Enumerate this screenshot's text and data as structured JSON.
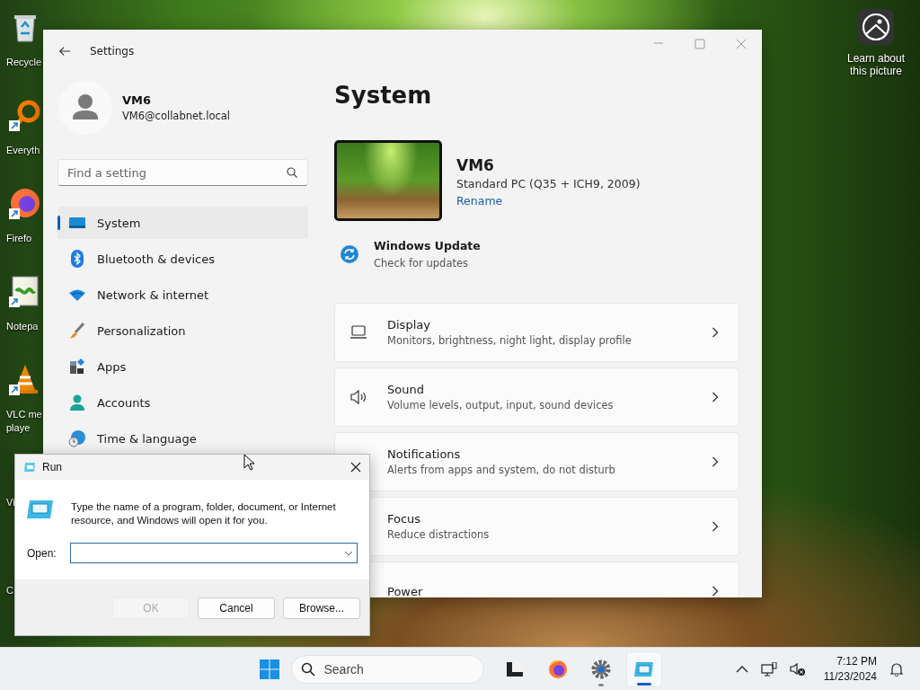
{
  "desktop": {
    "icons": [
      {
        "label": "Recycle",
        "kind": "bin"
      },
      {
        "label": "Everyth",
        "kind": "magnifier"
      },
      {
        "label": "Firefo",
        "kind": "browser"
      },
      {
        "label": "Notepa",
        "kind": "notepad"
      },
      {
        "label": "VLC me\nplaye",
        "kind": "cone"
      },
      {
        "label": "Vi",
        "kind": "text"
      },
      {
        "label": "C",
        "kind": "text"
      }
    ],
    "learn_more": {
      "label": "Learn about this picture"
    }
  },
  "settings": {
    "title": "Settings",
    "user": {
      "name": "VM6",
      "email": "VM6@collabnet.local"
    },
    "search": {
      "placeholder": "Find a setting"
    },
    "nav": [
      {
        "label": "System",
        "selected": true
      },
      {
        "label": "Bluetooth & devices",
        "selected": false
      },
      {
        "label": "Network & internet",
        "selected": false
      },
      {
        "label": "Personalization",
        "selected": false
      },
      {
        "label": "Apps",
        "selected": false
      },
      {
        "label": "Accounts",
        "selected": false
      },
      {
        "label": "Time & language",
        "selected": false
      }
    ],
    "page_title": "System",
    "device": {
      "name": "VM6",
      "model": "Standard PC (Q35 + ICH9, 2009)",
      "rename": "Rename"
    },
    "update": {
      "title": "Windows Update",
      "subtitle": "Check for updates"
    },
    "cards": [
      {
        "title": "Display",
        "subtitle": "Monitors, brightness, night light, display profile"
      },
      {
        "title": "Sound",
        "subtitle": "Volume levels, output, input, sound devices"
      },
      {
        "title": "Notifications",
        "subtitle": "Alerts from apps and system, do not disturb"
      },
      {
        "title": "Focus",
        "subtitle": "Reduce distractions"
      },
      {
        "title": "Power"
      }
    ]
  },
  "run": {
    "title": "Run",
    "description": "Type the name of a program, folder, document, or Internet resource, and Windows will open it for you.",
    "open_label": "Open:",
    "buttons": [
      {
        "label": "OK",
        "disabled": true
      },
      {
        "label": "Cancel",
        "disabled": false
      },
      {
        "label": "Browse...",
        "disabled": false
      }
    ]
  },
  "taskbar": {
    "search": {
      "placeholder": "Search"
    },
    "apps": [
      {
        "kind": "taskview",
        "running": false,
        "active": false
      },
      {
        "kind": "browser",
        "running": false,
        "active": false
      },
      {
        "kind": "settings",
        "running": true,
        "active": false
      },
      {
        "kind": "run",
        "running": true,
        "active": true
      }
    ],
    "time": "7:12 PM",
    "date": "11/23/2024"
  }
}
